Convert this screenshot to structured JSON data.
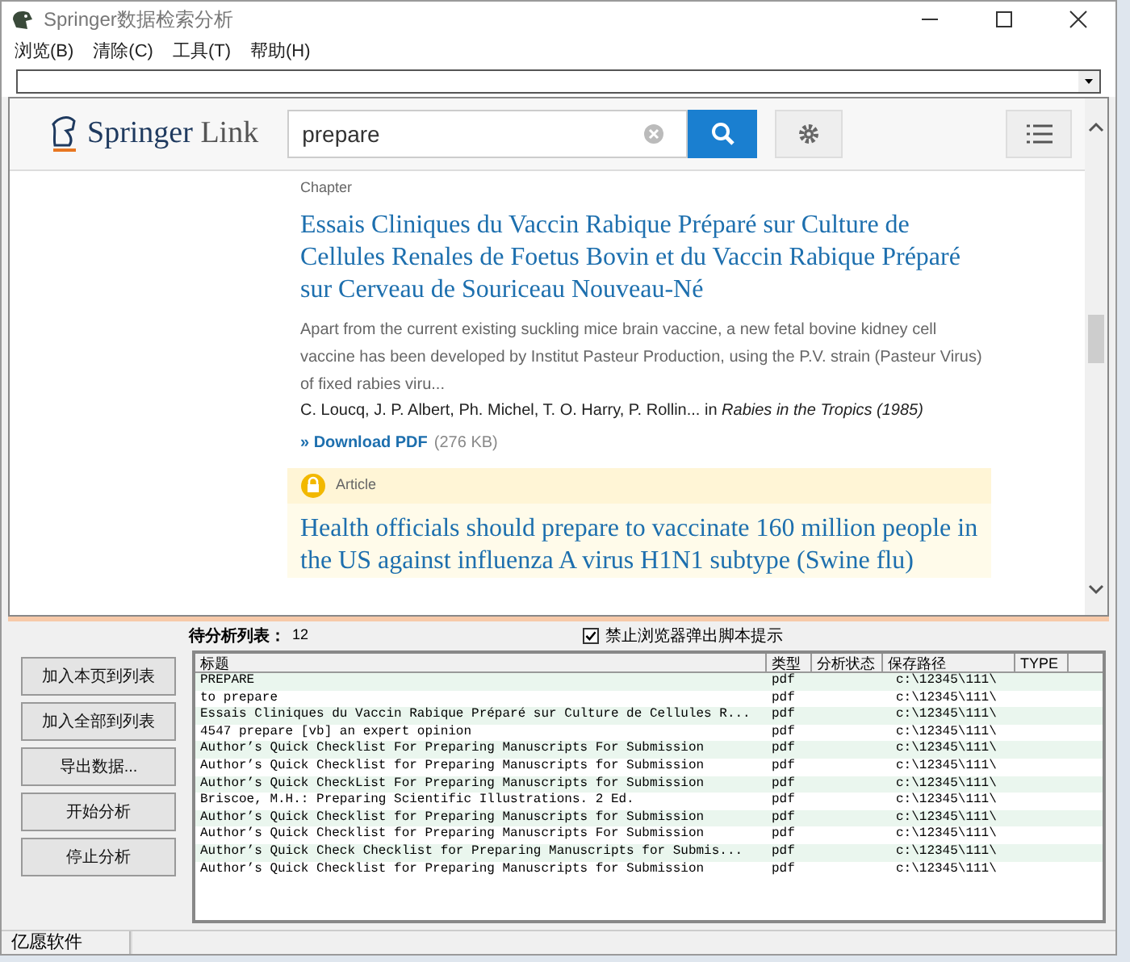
{
  "window": {
    "title": "Springer数据检索分析"
  },
  "menu": [
    "浏览(B)",
    "清除(C)",
    "工具(T)",
    "帮助(H)"
  ],
  "browser": {
    "logo": {
      "brand": "Springer",
      "product": "Link"
    },
    "search": {
      "value": "prepare"
    },
    "results": [
      {
        "kind": "chapter",
        "locked": false,
        "label": "Chapter",
        "title": "Essais Cliniques du Vaccin Rabique Préparé sur Culture de Cellules Renales de Foetus Bovin et du Vaccin Rabique Préparé sur Cerveau de Souriceau Nouveau-Né",
        "snippet": "Apart from the current existing suckling mice brain vaccine, a new fetal bovine kidney cell vaccine has been developed by Institut Pasteur Production, using the P.V. strain (Pasteur Virus) of fixed rabies viru...",
        "authors": "C. Loucq, J. P. Albert, Ph. Michel, T. O. Harry, P. Rollin... in *Rabies in the Tropics (1985)*",
        "download": "» Download PDF",
        "size": "(276 KB)"
      },
      {
        "kind": "article",
        "locked": true,
        "label": "Article",
        "title": "Health officials should prepare to vaccinate 160 million people in the US against influenza A virus H1N1 subtype (Swine flu)"
      }
    ]
  },
  "panel": {
    "list_label": "待分析列表：",
    "count": "12",
    "checkbox": {
      "label": "禁止浏览器弹出脚本提示",
      "checked": true
    },
    "buttons": [
      "加入本页到列表",
      "加入全部到列表",
      "导出数据...",
      "开始分析",
      "停止分析"
    ],
    "table": {
      "columns": [
        "标题",
        "类型",
        "分析状态",
        "保存路径",
        "TYPE"
      ],
      "rows": [
        {
          "title": "PREPARE",
          "type": "pdf",
          "path": "c:\\12345\\111\\"
        },
        {
          "title": "to prepare",
          "type": "pdf",
          "path": "c:\\12345\\111\\"
        },
        {
          "title": "Essais Cliniques du Vaccin Rabique Préparé sur Culture de Cellules R...",
          "type": "pdf",
          "path": "c:\\12345\\111\\"
        },
        {
          "title": "4547 prepare [vb] an expert opinion",
          "type": "pdf",
          "path": "c:\\12345\\111\\"
        },
        {
          "title": "Author’s Quick Checklist For Preparing Manuscripts For Submission",
          "type": "pdf",
          "path": "c:\\12345\\111\\"
        },
        {
          "title": "Author’s Quick Checklist for Preparing Manuscripts for Submission",
          "type": "pdf",
          "path": "c:\\12345\\111\\"
        },
        {
          "title": "Author’s Quick CheckList For Preparing Manuscripts for Submission",
          "type": "pdf",
          "path": "c:\\12345\\111\\"
        },
        {
          "title": "Briscoe, M.H.: Preparing Scientific Illustrations. 2 Ed.",
          "type": "pdf",
          "path": "c:\\12345\\111\\"
        },
        {
          "title": "Author’s Quick Checklist for Preparing Manuscripts for Submission",
          "type": "pdf",
          "path": "c:\\12345\\111\\"
        },
        {
          "title": "Author’s Quick Checklist for Preparing Manuscripts For Submission",
          "type": "pdf",
          "path": "c:\\12345\\111\\"
        },
        {
          "title": "Author’s Quick Check Checklist for Preparing Manuscripts for Submis...",
          "type": "pdf",
          "path": "c:\\12345\\111\\"
        },
        {
          "title": "Author’s Quick Checklist for Preparing Manuscripts for Submission",
          "type": "pdf",
          "path": "c:\\12345\\111\\"
        }
      ]
    }
  },
  "status_bar": {
    "text": "亿愿软件"
  }
}
